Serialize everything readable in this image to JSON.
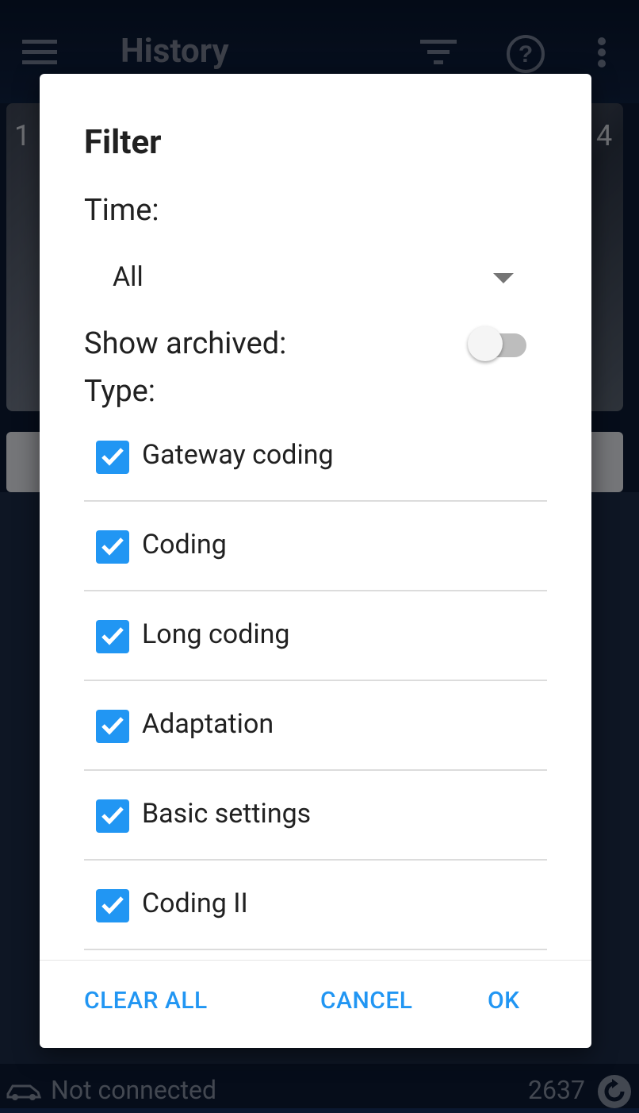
{
  "app_bar": {
    "title": "History",
    "icons": [
      "hamburger-icon",
      "filter-icon",
      "help-icon",
      "more-vert-icon"
    ]
  },
  "background": {
    "left_number": "1",
    "right_number": "4"
  },
  "status_bar": {
    "connection": "Not connected",
    "count": "2637"
  },
  "dialog": {
    "title": "Filter",
    "time_label": "Time:",
    "time_value": "All",
    "archived_label": "Show archived:",
    "archived_enabled": false,
    "type_label": "Type:",
    "types": [
      {
        "label": "Gateway coding",
        "checked": true
      },
      {
        "label": "Coding",
        "checked": true
      },
      {
        "label": "Long coding",
        "checked": true
      },
      {
        "label": "Adaptation",
        "checked": true
      },
      {
        "label": "Basic settings",
        "checked": true
      },
      {
        "label": "Coding II",
        "checked": true
      }
    ],
    "buttons": {
      "clear_all": "CLEAR ALL",
      "cancel": "CANCEL",
      "ok": "OK"
    }
  },
  "colors": {
    "accent": "#2196f3",
    "app_background": "#0b1830"
  }
}
